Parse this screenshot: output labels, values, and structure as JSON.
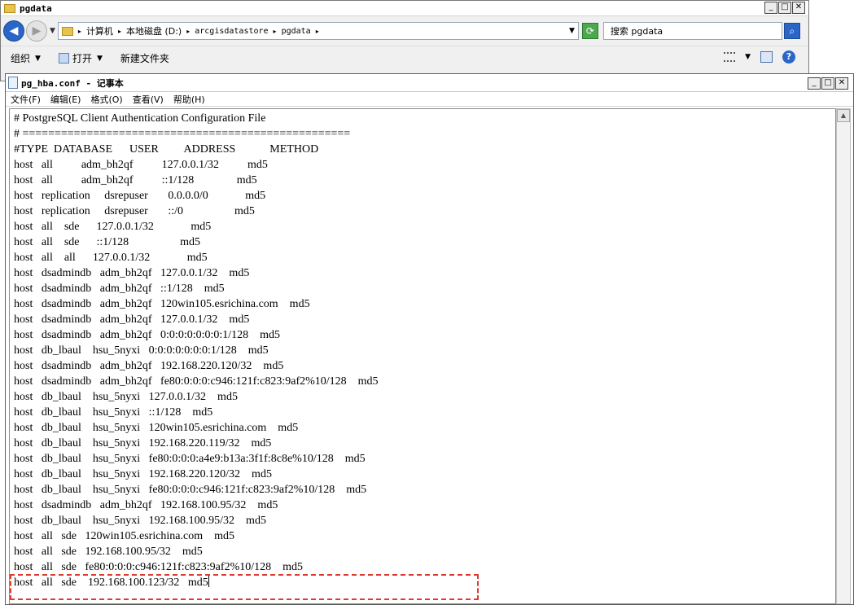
{
  "explorer": {
    "title": "pgdata",
    "breadcrumb": [
      "计算机",
      "本地磁盘 (D:)",
      "arcgisdatastore",
      "pgdata"
    ],
    "search_placeholder": "搜索 pgdata",
    "toolbar": {
      "organize": "组织",
      "open": "打开",
      "new_folder": "新建文件夹"
    }
  },
  "notepad": {
    "title": "pg_hba.conf - 记事本",
    "menu": [
      "文件(F)",
      "编辑(E)",
      "格式(O)",
      "查看(V)",
      "帮助(H)"
    ],
    "lines": [
      "# PostgreSQL Client Authentication Configuration File",
      "# ===================================================",
      "#TYPE  DATABASE      USER         ADDRESS            METHOD",
      "host   all          adm_bh2qf          127.0.0.1/32          md5",
      "host   all          adm_bh2qf          ::1/128               md5",
      "host   replication     dsrepuser       0.0.0.0/0             md5",
      "host   replication     dsrepuser       ::/0                  md5",
      "host   all    sde      127.0.0.1/32             md5",
      "host   all    sde      ::1/128                  md5",
      "host   all    all      127.0.0.1/32             md5",
      "host   dsadmindb   adm_bh2qf   127.0.0.1/32    md5",
      "host   dsadmindb   adm_bh2qf   ::1/128    md5",
      "host   dsadmindb   adm_bh2qf   120win105.esrichina.com    md5",
      "host   dsadmindb   adm_bh2qf   127.0.0.1/32    md5",
      "host   dsadmindb   adm_bh2qf   0:0:0:0:0:0:0:1/128    md5",
      "host   db_lbaul    hsu_5nyxi   0:0:0:0:0:0:0:1/128    md5",
      "host   dsadmindb   adm_bh2qf   192.168.220.120/32    md5",
      "host   dsadmindb   adm_bh2qf   fe80:0:0:0:c946:121f:c823:9af2%10/128    md5",
      "host   db_lbaul    hsu_5nyxi   127.0.0.1/32    md5",
      "host   db_lbaul    hsu_5nyxi   ::1/128    md5",
      "host   db_lbaul    hsu_5nyxi   120win105.esrichina.com    md5",
      "host   db_lbaul    hsu_5nyxi   192.168.220.119/32    md5",
      "host   db_lbaul    hsu_5nyxi   fe80:0:0:0:a4e9:b13a:3f1f:8c8e%10/128    md5",
      "host   db_lbaul    hsu_5nyxi   192.168.220.120/32    md5",
      "host   db_lbaul    hsu_5nyxi   fe80:0:0:0:c946:121f:c823:9af2%10/128    md5",
      "host   dsadmindb   adm_bh2qf   192.168.100.95/32    md5",
      "host   db_lbaul    hsu_5nyxi   192.168.100.95/32    md5",
      "host   all   sde   120win105.esrichina.com    md5",
      "host   all   sde   192.168.100.95/32    md5",
      "host   all   sde   fe80:0:0:0:c946:121f:c823:9af2%10/128    md5",
      "host   all   sde    192.168.100.123/32   md5"
    ]
  }
}
